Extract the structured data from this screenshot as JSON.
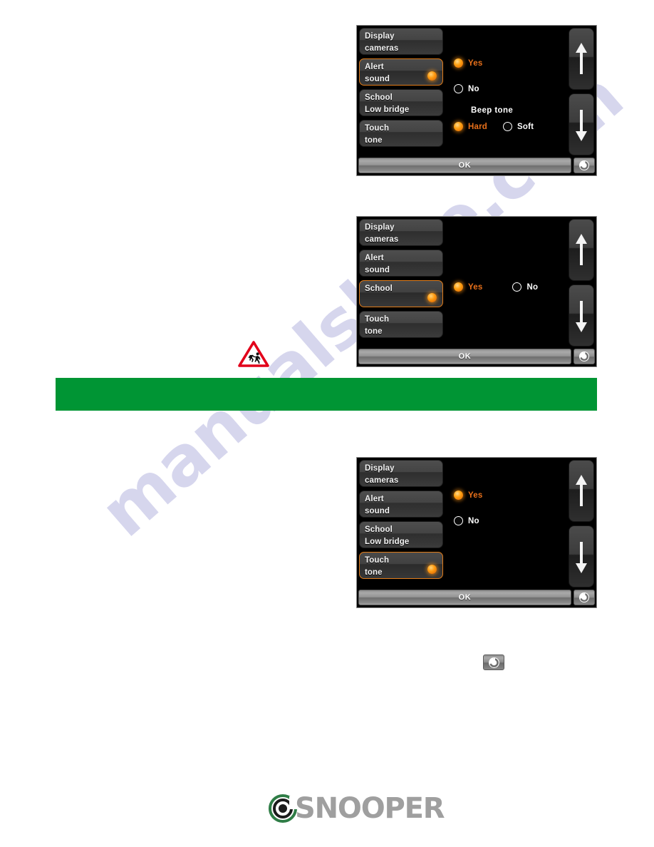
{
  "page": {
    "watermark_text": "manualshive.com",
    "green_band_text": "",
    "green_band_color": "#009534",
    "accent_color": "#e8701a",
    "school_sign_name": "school-crossing-warning-sign"
  },
  "footer": {
    "brand": "SNOOPER"
  },
  "standalone_back_icon": {
    "label": "back-icon"
  },
  "common": {
    "ok_label": "OK",
    "back_label": "back-icon",
    "scroll_up_label": "scroll-up",
    "scroll_down_label": "scroll-down"
  },
  "screens": [
    {
      "id": "alert-sound",
      "menu": [
        {
          "line1": "Display",
          "line2": "cameras",
          "selected": false
        },
        {
          "line1": "Alert",
          "line2": "sound",
          "selected": true
        },
        {
          "line1": "School",
          "line2": "Low bridge",
          "selected": false
        },
        {
          "line1": "Touch",
          "line2": "tone",
          "selected": false
        }
      ],
      "options": [
        {
          "label": "Yes",
          "selected": true
        },
        {
          "label": "No",
          "selected": false
        }
      ],
      "section_title": "Beep tone",
      "tone_options": [
        {
          "label": "Hard",
          "selected": true
        },
        {
          "label": "Soft",
          "selected": false
        }
      ],
      "ok_label": "OK"
    },
    {
      "id": "school",
      "menu": [
        {
          "line1": "Display",
          "line2": "cameras",
          "selected": false
        },
        {
          "line1": "Alert",
          "line2": "sound",
          "selected": false
        },
        {
          "line1": "School",
          "line2": "",
          "selected": true
        },
        {
          "line1": "Touch",
          "line2": "tone",
          "selected": false
        }
      ],
      "options": [
        {
          "label": "Yes",
          "selected": true
        },
        {
          "label": "No",
          "selected": false
        }
      ],
      "ok_label": "OK"
    },
    {
      "id": "touch-tone",
      "menu": [
        {
          "line1": "Display",
          "line2": "cameras",
          "selected": false
        },
        {
          "line1": "Alert",
          "line2": "sound",
          "selected": false
        },
        {
          "line1": "School",
          "line2": "Low bridge",
          "selected": false
        },
        {
          "line1": "Touch",
          "line2": "tone",
          "selected": true
        }
      ],
      "options": [
        {
          "label": "Yes",
          "selected": true
        },
        {
          "label": "No",
          "selected": false
        }
      ],
      "ok_label": "OK"
    }
  ]
}
